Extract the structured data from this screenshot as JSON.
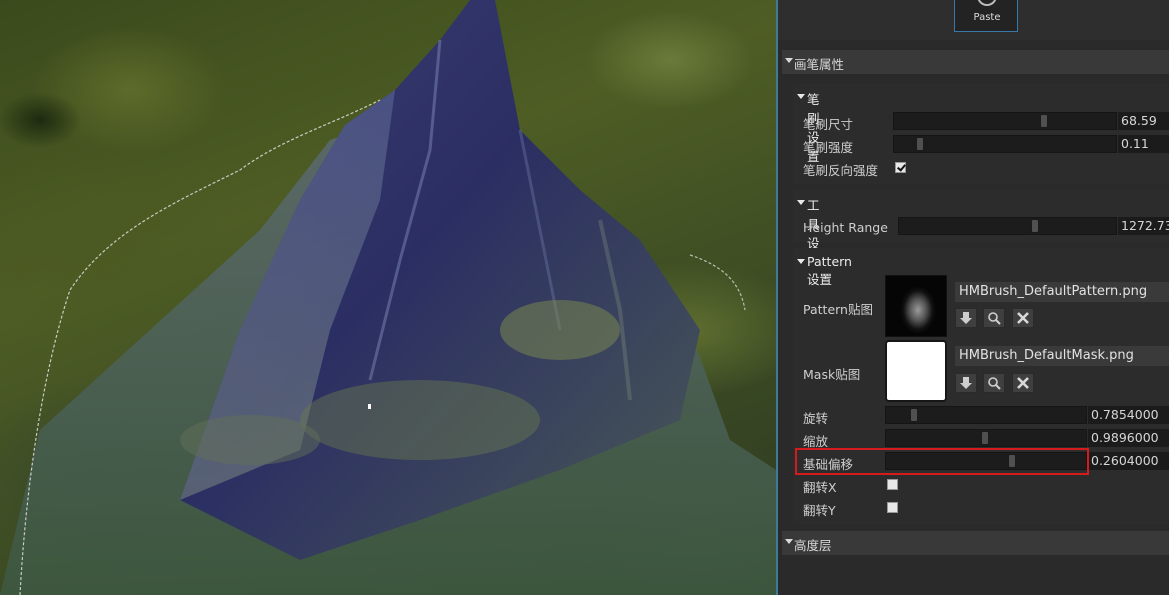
{
  "toolbar": {
    "paste_label": "Paste"
  },
  "sections": {
    "brush_properties": "画笔属性",
    "height_layers": "高度层"
  },
  "brush_settings": {
    "title": "笔刷设置",
    "size": {
      "label": "笔刷尺寸",
      "value": "68.59",
      "fraction": 0.68
    },
    "strength": {
      "label": "笔刷强度",
      "value": "0.11",
      "fraction": 0.11
    },
    "invert_strength": {
      "label": "笔刷反向强度",
      "checked": true
    }
  },
  "tool_settings": {
    "title": "工具设置",
    "height_range": {
      "label": "Height Range",
      "value": "1272.73",
      "fraction": 0.64
    }
  },
  "pattern_settings": {
    "title": "Pattern设置",
    "pattern_texture": {
      "label": "Pattern贴图",
      "file": "HMBrush_DefaultPattern.png"
    },
    "mask_texture": {
      "label": "Mask贴图",
      "file": "HMBrush_DefaultMask.png"
    },
    "rotation": {
      "label": "旋转",
      "value": "0.7854000",
      "fraction": 0.13
    },
    "scale": {
      "label": "缩放",
      "value": "0.9896000",
      "fraction": 0.49
    },
    "base_offset": {
      "label": "基础偏移",
      "value": "0.2604000",
      "fraction": 0.63
    },
    "flip_x": {
      "label": "翻转X",
      "checked": false
    },
    "flip_y": {
      "label": "翻转Y",
      "checked": false
    }
  },
  "icons": {
    "load": "down-arrow-icon",
    "browse": "magnifier-icon",
    "clear": "close-x-icon"
  },
  "colors": {
    "highlight": "#d41c1c",
    "accent": "#3a78a8"
  }
}
